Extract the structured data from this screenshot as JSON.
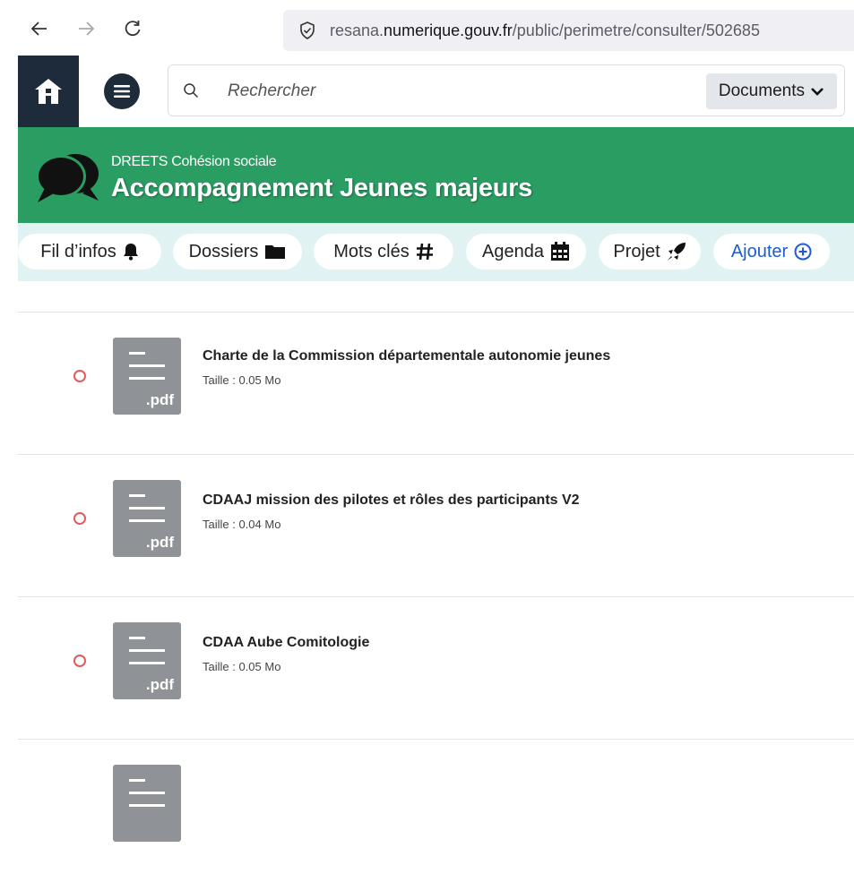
{
  "browser": {
    "url_prefix": "resana.",
    "url_domain": "numerique.gouv.fr",
    "url_path": "/public/perimetre/consulter/502685",
    "back_icon": "arrow-left-icon",
    "forward_icon": "arrow-right-icon",
    "reload_icon": "reload-icon",
    "shield_icon": "shield-icon"
  },
  "header": {
    "search_placeholder": "Rechercher",
    "search_value": "",
    "scope_label": "Documents",
    "home_icon": "home-icon",
    "menu_icon": "menu-icon"
  },
  "banner": {
    "subtitle": "DREETS Cohésion sociale",
    "title": "Accompagnement Jeunes majeurs",
    "color": "#2a9d63"
  },
  "tabs": [
    {
      "label": "Fil d’infos",
      "icon": "bell-icon"
    },
    {
      "label": "Dossiers",
      "icon": "folder-icon"
    },
    {
      "label": "Mots clés",
      "icon": "hashtag-icon"
    },
    {
      "label": "Agenda",
      "icon": "calendar-icon"
    },
    {
      "label": "Projet",
      "icon": "rocket-icon"
    },
    {
      "label": "Ajouter",
      "icon": "plus-circle-icon"
    }
  ],
  "documents": [
    {
      "title": "Charte de la Commission départementale autonomie jeunes",
      "size": "Taille : 0.05 Mo",
      "ext": ".pdf"
    },
    {
      "title": "CDAAJ mission des pilotes et rôles des participants V2",
      "size": "Taille : 0.04 Mo",
      "ext": ".pdf"
    },
    {
      "title": "CDAA Aube Comitologie",
      "size": "Taille : 0.05 Mo",
      "ext": ".pdf"
    },
    {
      "title": "",
      "size": "",
      "ext": ""
    }
  ]
}
